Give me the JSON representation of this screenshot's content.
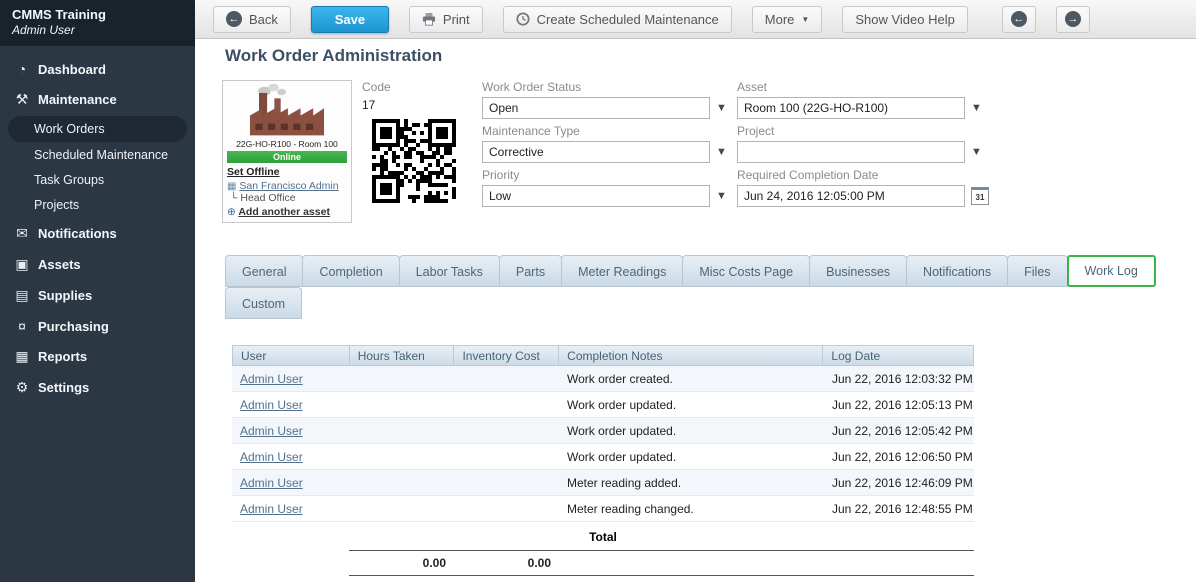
{
  "page": {
    "title": "Work Order Administration"
  },
  "sidebar": {
    "app_title": "CMMS Training",
    "app_subtitle": "Admin User",
    "items": {
      "dashboard": "Dashboard",
      "maintenance": "Maintenance",
      "notifications": "Notifications",
      "assets": "Assets",
      "supplies": "Supplies",
      "purchasing": "Purchasing",
      "reports": "Reports",
      "settings": "Settings"
    },
    "maintenance_subitems": {
      "work_orders": "Work Orders",
      "scheduled_maintenance": "Scheduled Maintenance",
      "task_groups": "Task Groups",
      "projects": "Projects"
    },
    "active_item": "Work Orders"
  },
  "icons": {
    "dashboard": "◔",
    "maintenance": "⚒",
    "notifications": "✉",
    "assets": "▣",
    "supplies": "▤",
    "purchasing": "¤",
    "reports": "▦",
    "settings": "⚙",
    "back_arrow": "←",
    "prev_arrow": "←",
    "next_arrow": "→",
    "dropdown_caret": "▼",
    "business": "▦",
    "tree_branch": "└",
    "add_circle": "⊕",
    "calendar_day": "31"
  },
  "toolbar": {
    "back": "Back",
    "save": "Save",
    "print": "Print",
    "create_scheduled_maintenance": "Create Scheduled Maintenance",
    "more": "More",
    "show_video_help": "Show Video Help"
  },
  "asset_panel": {
    "caption": "22G-HO-R100 - Room 100",
    "status_badge": "Online",
    "set_offline_link": "Set Offline",
    "business_link": "San Francisco Admin",
    "location": "Head Office",
    "add_asset_link": "Add another asset"
  },
  "form": {
    "code": {
      "label": "Code",
      "value": "17"
    },
    "work_order_status": {
      "label": "Work Order Status",
      "value": "Open"
    },
    "asset": {
      "label": "Asset",
      "value": "Room 100 (22G-HO-R100)"
    },
    "maintenance_type": {
      "label": "Maintenance Type",
      "value": "Corrective"
    },
    "project": {
      "label": "Project",
      "value": ""
    },
    "priority": {
      "label": "Priority",
      "value": "Low"
    },
    "required_completion_date": {
      "label": "Required Completion Date",
      "value": "Jun 24, 2016 12:05:00 PM"
    }
  },
  "tabs": {
    "row1": [
      "General",
      "Completion",
      "Labor Tasks",
      "Parts",
      "Meter Readings",
      "Misc Costs Page",
      "Businesses",
      "Notifications",
      "Files",
      "Work Log"
    ],
    "row2": [
      "Custom"
    ],
    "active": "Work Log"
  },
  "work_log": {
    "columns": [
      "User",
      "Hours Taken",
      "Inventory Cost",
      "Completion Notes",
      "Log Date"
    ],
    "rows": [
      {
        "user": "Admin User",
        "notes": "Work order created.",
        "date": "Jun 22, 2016 12:03:32 PM"
      },
      {
        "user": "Admin User",
        "notes": "Work order updated.",
        "date": "Jun 22, 2016 12:05:13 PM"
      },
      {
        "user": "Admin User",
        "notes": "Work order updated.",
        "date": "Jun 22, 2016 12:05:42 PM"
      },
      {
        "user": "Admin User",
        "notes": "Work order updated.",
        "date": "Jun 22, 2016 12:06:50 PM"
      },
      {
        "user": "Admin User",
        "notes": "Meter reading added.",
        "date": "Jun 22, 2016 12:46:09 PM"
      },
      {
        "user": "Admin User",
        "notes": "Meter reading changed.",
        "date": "Jun 22, 2016 12:48:55 PM"
      }
    ],
    "totals": {
      "label": "Total",
      "hours_taken": "0.00",
      "inventory_cost": "0.00"
    }
  },
  "colors": {
    "save_button": "#27a5de",
    "online_badge": "#3fae49",
    "active_tab_highlight": "#3cb44a",
    "sidebar_background": "#2b3743",
    "link_text": "#50708c"
  }
}
